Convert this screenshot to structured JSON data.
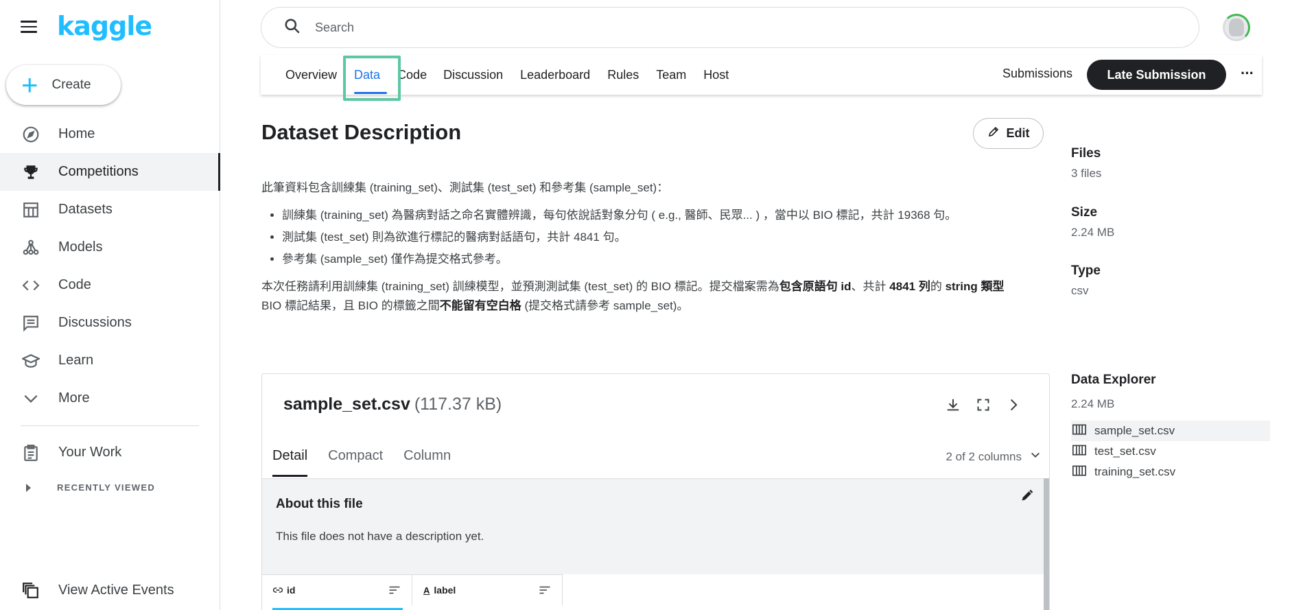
{
  "sidebar": {
    "logo": "kaggle",
    "create_label": "Create",
    "items": [
      {
        "label": "Home",
        "icon": "compass-icon"
      },
      {
        "label": "Competitions",
        "icon": "trophy-icon"
      },
      {
        "label": "Datasets",
        "icon": "table-icon"
      },
      {
        "label": "Models",
        "icon": "models-icon"
      },
      {
        "label": "Code",
        "icon": "code-icon"
      },
      {
        "label": "Discussions",
        "icon": "discussion-icon"
      },
      {
        "label": "Learn",
        "icon": "learn-icon"
      },
      {
        "label": "More",
        "icon": "chevron-down-icon"
      }
    ],
    "your_work": "Your Work",
    "recently_viewed": "RECENTLY VIEWED",
    "view_active_events": "View Active Events"
  },
  "search": {
    "placeholder": "Search"
  },
  "tabs": [
    "Overview",
    "Data",
    "Code",
    "Discussion",
    "Leaderboard",
    "Rules",
    "Team",
    "Host"
  ],
  "active_tab": "Data",
  "header_actions": {
    "submissions": "Submissions",
    "late_submission": "Late Submission",
    "more": "···"
  },
  "description": {
    "title": "Dataset Description",
    "edit_label": "Edit",
    "intro": "此筆資料包含訓練集 (training_set)、測試集 (test_set) 和參考集 (sample_set)：",
    "bullets": [
      "訓練集 (training_set) 為醫病對話之命名實體辨識，每句依說話對象分句 ( e.g., 醫師、民眾... ) ，當中以 BIO 標記，共計 19368 句。",
      "測試集 (test_set) 則為欲進行標記的醫病對話語句，共計 4841 句。",
      "參考集 (sample_set) 僅作為提交格式參考。"
    ],
    "task_1": "本次任務請利用訓練集 (training_set) 訓練模型，並預測測試集 (test_set) 的 BIO 標記。提交檔案需為",
    "task_bold_1": "包含原語句 id",
    "task_2": "、共計 ",
    "task_bold_2": "4841 列",
    "task_3": "的 ",
    "task_bold_3": "string 類型",
    "task_4": "BIO 標記結果，且 BIO 的標籤之間",
    "task_bold_4": "不能留有空白格",
    "task_5": " (提交格式請參考 sample_set)。"
  },
  "meta": {
    "files_label": "Files",
    "files_value": "3 files",
    "size_label": "Size",
    "size_value": "2.24 MB",
    "type_label": "Type",
    "type_value": "csv"
  },
  "file_panel": {
    "name": "sample_set.csv",
    "size": "(117.37 kB)",
    "tabs": [
      "Detail",
      "Compact",
      "Column"
    ],
    "columns_count": "2 of 2 columns",
    "about_title": "About this file",
    "about_text": "This file does not have a description yet.",
    "columns": [
      "id",
      "label"
    ]
  },
  "explorer": {
    "title": "Data Explorer",
    "size": "2.24 MB",
    "files": [
      "sample_set.csv",
      "test_set.csv",
      "training_set.csv"
    ],
    "selected": "sample_set.csv"
  }
}
